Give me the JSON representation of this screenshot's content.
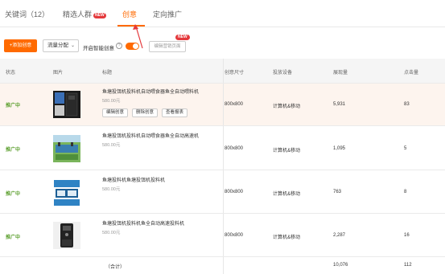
{
  "tabs": [
    {
      "label": "关键词（12）"
    },
    {
      "label": "精选人群",
      "badge": "NEW"
    },
    {
      "label": "创意"
    },
    {
      "label": "定向推广"
    }
  ],
  "toolbar": {
    "add_label": "+添加创意",
    "traffic_label": "流量分配",
    "smart_label": "开启智能创意",
    "help_icon": "?",
    "edit_page_label": "编辑营销页面",
    "new_badge": "NEW"
  },
  "table": {
    "headers": [
      "状态",
      "图片",
      "标题",
      "创意尺寸",
      "投放设备",
      "展现量",
      "点击量"
    ],
    "rows": [
      {
        "status": "推广中",
        "title": "鱼塘投饵机投料机自动喂食器鱼全自动喂料机",
        "price": "580.00元",
        "size": "800x800",
        "device": "计算机&移动",
        "impressions": "5,931",
        "clicks": "83",
        "ops": [
          "编辑创意",
          "删除创意",
          "查看报表"
        ]
      },
      {
        "status": "推广中",
        "title": "鱼塘投饵机投料机自动喂食器鱼全自动高速机",
        "price": "580.00元",
        "size": "800x800",
        "device": "计算机&移动",
        "impressions": "1,095",
        "clicks": "5"
      },
      {
        "status": "推广中",
        "title": "鱼塘投料机鱼塘投饵机投料机",
        "price": "580.00元",
        "size": "800x800",
        "device": "计算机&移动",
        "impressions": "763",
        "clicks": "8"
      },
      {
        "status": "推广中",
        "title": "鱼塘投饵机投料机鱼全自动高速投料机",
        "price": "580.00元",
        "size": "800x800",
        "device": "计算机&移动",
        "impressions": "2,287",
        "clicks": "16"
      }
    ],
    "total": {
      "label": "（合计）",
      "impressions": "10,076",
      "clicks": "112"
    }
  },
  "colors": {
    "accent": "#ff6a00",
    "status_green": "#5a9e2c",
    "new_badge": "#e4393c",
    "annotation_arrow": "#e4393c"
  }
}
